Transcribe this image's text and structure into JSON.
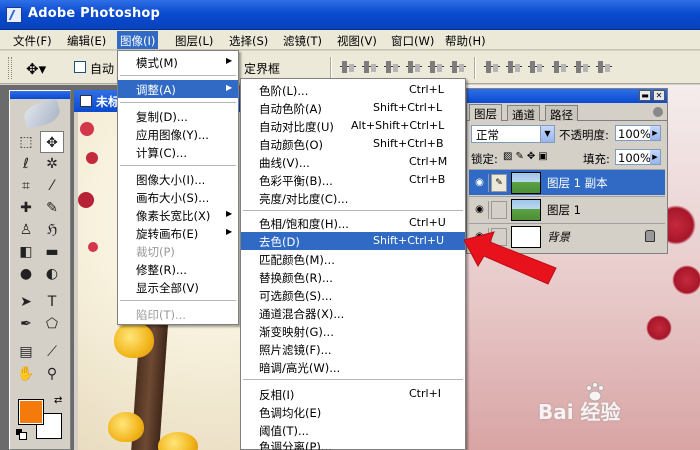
{
  "app": {
    "title": "Adobe Photoshop",
    "icon": "photoshop-icon"
  },
  "menubar": [
    {
      "label": "文件(F)",
      "active": false
    },
    {
      "label": "编辑(E)",
      "active": false
    },
    {
      "label": "图像(I)",
      "active": true
    },
    {
      "label": "图层(L)",
      "active": false
    },
    {
      "label": "选择(S)",
      "active": false
    },
    {
      "label": "滤镜(T)",
      "active": false
    },
    {
      "label": "视图(V)",
      "active": false
    },
    {
      "label": "窗口(W)",
      "active": false
    },
    {
      "label": "帮助(H)",
      "active": false
    }
  ],
  "optionsbar": {
    "auto_select_label": "自动",
    "bounds_label": "定界框",
    "tool_icon": "move-tool-icon"
  },
  "document": {
    "title": "未标"
  },
  "image_menu": {
    "items": [
      {
        "label": "模式(M)",
        "submenu": true,
        "highlight": false,
        "disabled": false
      },
      {
        "label": "调整(A)",
        "submenu": true,
        "highlight": true,
        "disabled": false
      },
      {
        "label": "复制(D)...",
        "submenu": false,
        "highlight": false,
        "disabled": false
      },
      {
        "label": "应用图像(Y)...",
        "submenu": false,
        "highlight": false,
        "disabled": false
      },
      {
        "label": "计算(C)...",
        "submenu": false,
        "highlight": false,
        "disabled": false
      },
      {
        "label": "图像大小(I)...",
        "submenu": false,
        "highlight": false,
        "disabled": false
      },
      {
        "label": "画布大小(S)...",
        "submenu": false,
        "highlight": false,
        "disabled": false
      },
      {
        "label": "像素长宽比(X)",
        "submenu": true,
        "highlight": false,
        "disabled": false
      },
      {
        "label": "旋转画布(E)",
        "submenu": true,
        "highlight": false,
        "disabled": false
      },
      {
        "label": "裁切(P)",
        "submenu": false,
        "highlight": false,
        "disabled": true
      },
      {
        "label": "修整(R)...",
        "submenu": false,
        "highlight": false,
        "disabled": false
      },
      {
        "label": "显示全部(V)",
        "submenu": false,
        "highlight": false,
        "disabled": false
      },
      {
        "label": "陷印(T)...",
        "submenu": false,
        "highlight": false,
        "disabled": true
      }
    ]
  },
  "adjust_menu": {
    "items": [
      {
        "label": "色阶(L)...",
        "shortcut": "Ctrl+L",
        "highlight": false
      },
      {
        "label": "自动色阶(A)",
        "shortcut": "Shift+Ctrl+L",
        "highlight": false
      },
      {
        "label": "自动对比度(U)",
        "shortcut": "Alt+Shift+Ctrl+L",
        "highlight": false
      },
      {
        "label": "自动颜色(O)",
        "shortcut": "Shift+Ctrl+B",
        "highlight": false
      },
      {
        "label": "曲线(V)...",
        "shortcut": "Ctrl+M",
        "highlight": false
      },
      {
        "label": "色彩平衡(B)...",
        "shortcut": "Ctrl+B",
        "highlight": false
      },
      {
        "label": "亮度/对比度(C)...",
        "shortcut": "",
        "highlight": false
      },
      {
        "label": "色相/饱和度(H)...",
        "shortcut": "Ctrl+U",
        "highlight": false
      },
      {
        "label": "去色(D)",
        "shortcut": "Shift+Ctrl+U",
        "highlight": true
      },
      {
        "label": "匹配颜色(M)...",
        "shortcut": "",
        "highlight": false
      },
      {
        "label": "替换颜色(R)...",
        "shortcut": "",
        "highlight": false
      },
      {
        "label": "可选颜色(S)...",
        "shortcut": "",
        "highlight": false
      },
      {
        "label": "通道混合器(X)...",
        "shortcut": "",
        "highlight": false
      },
      {
        "label": "渐变映射(G)...",
        "shortcut": "",
        "highlight": false
      },
      {
        "label": "照片滤镜(F)...",
        "shortcut": "",
        "highlight": false
      },
      {
        "label": "暗调/高光(W)...",
        "shortcut": "",
        "highlight": false
      },
      {
        "label": "反相(I)",
        "shortcut": "Ctrl+I",
        "highlight": false
      },
      {
        "label": "色调均化(E)",
        "shortcut": "",
        "highlight": false
      },
      {
        "label": "阈值(T)...",
        "shortcut": "",
        "highlight": false
      },
      {
        "label": "色调分离(P)...",
        "shortcut": "",
        "highlight": false
      }
    ]
  },
  "layers_panel": {
    "tabs": [
      "图层",
      "通道",
      "路径"
    ],
    "blend_mode": "正常",
    "opacity_label": "不透明度:",
    "opacity_value": "100%",
    "lock_label": "锁定:",
    "fill_label": "填充:",
    "fill_value": "100%",
    "layers": [
      {
        "name": "图层 1 副本",
        "selected": true,
        "thumb": "landscape"
      },
      {
        "name": "图层 1",
        "selected": false,
        "thumb": "landscape"
      },
      {
        "name": "背景",
        "selected": false,
        "thumb": "white",
        "locked": true
      }
    ]
  },
  "colors": {
    "foreground": "#f47a0b",
    "background": "#ffffff",
    "menu_highlight": "#316ac5",
    "titlebar": "#0a4ad0",
    "arrow": "#e8121c"
  },
  "watermark": {
    "text": "Bai 经验"
  }
}
